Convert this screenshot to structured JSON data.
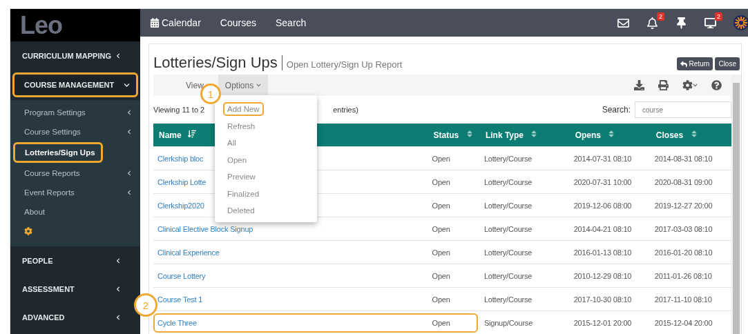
{
  "sidebar": {
    "logo": "Leo",
    "items": [
      {
        "label": "CURRICULUM MAPPING",
        "expanded": false,
        "highlighted": false
      },
      {
        "label": "COURSE MANAGEMENT",
        "expanded": true,
        "highlighted": true,
        "children": [
          {
            "kind": "link",
            "label": "Program Settings",
            "submenu": true,
            "selected": false,
            "highlighted": false
          },
          {
            "kind": "link",
            "label": "Course Settings",
            "submenu": true,
            "selected": false,
            "highlighted": false
          },
          {
            "kind": "link",
            "label": "Lotteries/Sign Ups",
            "submenu": false,
            "selected": true,
            "highlighted": true
          },
          {
            "kind": "link",
            "label": "Course Reports",
            "submenu": true,
            "selected": false,
            "highlighted": false
          },
          {
            "kind": "link",
            "label": "Event Reports",
            "submenu": true,
            "selected": false,
            "highlighted": false
          },
          {
            "kind": "link",
            "label": "About",
            "submenu": false,
            "selected": false,
            "highlighted": false
          },
          {
            "kind": "gear"
          }
        ]
      },
      {
        "label": "PEOPLE",
        "expanded": false,
        "highlighted": false
      },
      {
        "label": "ASSESSMENT",
        "expanded": false,
        "highlighted": false
      },
      {
        "label": "ADVANCED",
        "expanded": false,
        "highlighted": false
      }
    ]
  },
  "topbar": {
    "nav": [
      {
        "label": "Calendar",
        "kind": "calendar"
      },
      {
        "label": "Courses",
        "kind": "plain"
      },
      {
        "label": "Search",
        "kind": "plain"
      }
    ],
    "icons": [
      {
        "kind": "mail"
      },
      {
        "kind": "bell",
        "badge": "2"
      },
      {
        "kind": "pin"
      },
      {
        "kind": "monitor",
        "badge": "2"
      },
      {
        "kind": "avatar"
      }
    ]
  },
  "page": {
    "title": "Lotteries/Sign Ups",
    "subtitle": "Open Lottery/Sign Up Report",
    "buttons": [
      {
        "label": "Return",
        "kind": "return"
      },
      {
        "label": "Close",
        "kind": "plain"
      }
    ]
  },
  "toolbar": {
    "menus": [
      {
        "label": "View",
        "selected": false
      },
      {
        "label": "Options",
        "selected": true
      }
    ],
    "icons": [
      {
        "kind": "download"
      },
      {
        "kind": "print"
      },
      {
        "kind": "gear"
      },
      {
        "kind": "help"
      }
    ]
  },
  "options_menu": [
    {
      "label": "Add New",
      "highlighted": true
    },
    {
      "label": "Refresh",
      "highlighted": false
    },
    {
      "label": "All",
      "highlighted": false
    },
    {
      "label": "Open",
      "highlighted": false
    },
    {
      "label": "Preview",
      "highlighted": false
    },
    {
      "label": "Finalized",
      "highlighted": false
    },
    {
      "label": "Deleted",
      "highlighted": false
    }
  ],
  "info": {
    "before": "Viewing 11 to 2",
    "after": "entries)"
  },
  "search": {
    "label": "Search:",
    "value": "course"
  },
  "table": {
    "columns": [
      {
        "label": "Name",
        "sorted": true
      },
      {
        "label": "Status",
        "sorted": false
      },
      {
        "label": "Link Type",
        "sorted": false
      },
      {
        "label": "Opens",
        "sorted": false
      },
      {
        "label": "Closes",
        "sorted": false
      }
    ],
    "rows": [
      {
        "name": "Clerkship bloc",
        "status": "Open",
        "link_type": "Lottery/Course",
        "opens": "2014-07-31 08:10",
        "closes": "2014-08-31 08:10",
        "highlighted": false
      },
      {
        "name": "Clerkship Lotte",
        "status": "Open",
        "link_type": "Lottery/Course",
        "opens": "2020-07-31 10:00",
        "closes": "2020-08-31 09:00",
        "highlighted": false
      },
      {
        "name": "Clerkship2020",
        "status": "Open",
        "link_type": "Lottery/Course",
        "opens": "2019-12-06 08:00",
        "closes": "2019-12-27 20:00",
        "highlighted": false
      },
      {
        "name": "Clinical Elective Block Signup",
        "status": "Open",
        "link_type": "Lottery/Course",
        "opens": "2014-04-21 08:10",
        "closes": "2017-03-03 08:10",
        "highlighted": false
      },
      {
        "name": "Clinical Experience",
        "status": "Open",
        "link_type": "Lottery/Course",
        "opens": "2016-01-13 08:10",
        "closes": "2016-01-20 08:10",
        "highlighted": false
      },
      {
        "name": "Course Lottery",
        "status": "Open",
        "link_type": "Lottery/Course",
        "opens": "2010-12-29 08:10",
        "closes": "2011-01-26 08:10",
        "highlighted": false
      },
      {
        "name": "Course Test 1",
        "status": "Open",
        "link_type": "Lottery/Course",
        "opens": "2017-10-30 08:10",
        "closes": "2017-11-10 08:10",
        "highlighted": false
      },
      {
        "name": "Cycle Three",
        "status": "Open",
        "link_type": "Signup/Course",
        "opens": "2015-12-01 20:00",
        "closes": "2015-12-04 20:00",
        "highlighted": true
      }
    ]
  },
  "callouts": [
    {
      "number": "1"
    },
    {
      "number": "2"
    }
  ]
}
